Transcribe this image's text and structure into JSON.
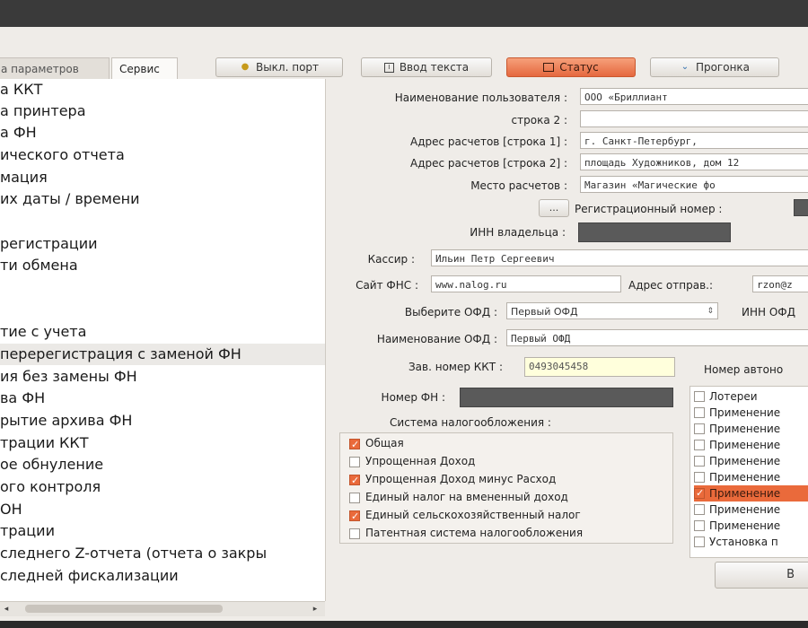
{
  "tabs": [
    "а параметров",
    "Сервис"
  ],
  "toolbar": {
    "port_button": "Выкл. порт",
    "text_button": "Ввод текста",
    "status_button": "Статус",
    "progon_button": "Прогонка"
  },
  "left_list": [
    "а ККТ",
    "а принтера",
    "а ФН",
    "ического отчета",
    "мация",
    "их даты / времени",
    "",
    "регистрации",
    "ти обмена",
    "",
    "",
    "",
    "тие с учета",
    "перерегистрация с заменой ФН",
    "ия без замены ФН",
    "ва ФН",
    "рытие архива ФН",
    "трации ККТ",
    "ое обнуление",
    "ого контроля",
    "ОН",
    "трации",
    "следнего Z-отчета (отчета о закры",
    "следней фискализации"
  ],
  "form": {
    "user_name_label": "Наименование пользователя :",
    "user_name_value": "ООО «Бриллиант",
    "line2_label": "строка 2 :",
    "line2_value": "",
    "addr1_label": "Адрес расчетов [строка 1] :",
    "addr1_value": "г. Санкт-Петербург,",
    "addr2_label": "Адрес расчетов [строка 2] :",
    "addr2_value": "площадь Художников, дом 12",
    "place_label": "Место расчетов :",
    "place_value": "Магазин «Магические фо",
    "small_button": "...",
    "reg_number_label": "Регистрационный номер :",
    "inn_owner_label": "ИНН владельца :",
    "cashier_label": "Кассир :",
    "cashier_value": "Ильин Петр Сергеевич",
    "fns_site_label": "Сайт ФНС :",
    "fns_site_value": "www.nalog.ru",
    "sender_addr_label": "Адрес отправ.:",
    "sender_addr_value": "rzon@z",
    "ofd_select_label": "Выберите ОФД :",
    "ofd_select_value": "Первый ОФД",
    "inn_ofd_label": "ИНН ОФД",
    "ofd_name_label": "Наименование ОФД :",
    "ofd_name_value": "Первый ОФД",
    "kkt_serial_label": "Зав. номер ККТ :",
    "kkt_serial_value": "0493045458",
    "fn_number_label": "Номер ФН :",
    "tax_system_label": "Система налогообложения :"
  },
  "tax_systems": [
    {
      "label": "Общая",
      "checked": true
    },
    {
      "label": "Упрощенная Доход",
      "checked": false
    },
    {
      "label": "Упрощенная Доход минус Расход",
      "checked": true
    },
    {
      "label": "Единый налог на вмененный доход",
      "checked": false
    },
    {
      "label": "Единый сельскохозяйственный налог",
      "checked": true
    },
    {
      "label": "Патентная система налогообложения",
      "checked": false
    }
  ],
  "autonomous": {
    "header": "Номер автоно",
    "items": [
      {
        "label": "Лотереи",
        "checked": false
      },
      {
        "label": "Применение",
        "checked": false
      },
      {
        "label": "Применение",
        "checked": false
      },
      {
        "label": "Применение",
        "checked": false
      },
      {
        "label": "Применение",
        "checked": false
      },
      {
        "label": "Применение",
        "checked": false
      },
      {
        "label": "Применение",
        "checked": true
      },
      {
        "label": "Применение",
        "checked": false
      },
      {
        "label": "Применение",
        "checked": false
      },
      {
        "label": "Установка п",
        "checked": false
      }
    ]
  },
  "bottom_button": "В",
  "colors": {
    "accent": "#ea6a3b",
    "frame": "#efece8",
    "titlebar": "#3a3a3a"
  }
}
